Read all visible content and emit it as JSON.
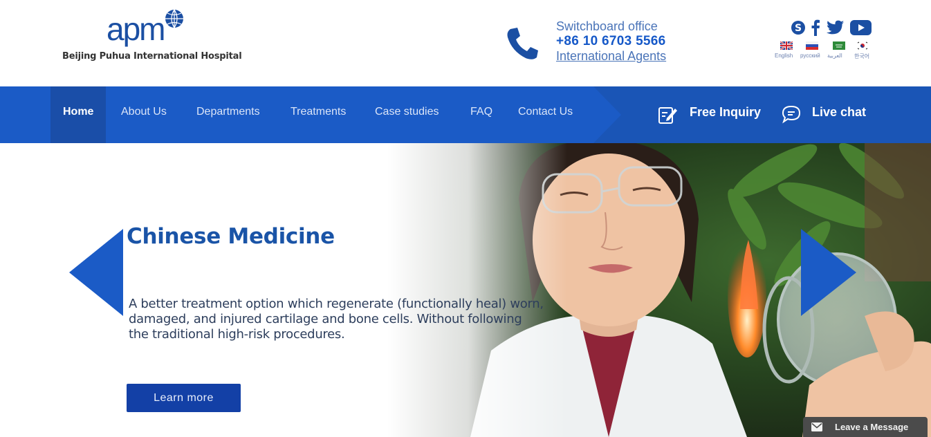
{
  "header": {
    "logo_text": "apm",
    "logo_subtitle": "Beijing Puhua International Hospital",
    "switchboard_title": "Switchboard office",
    "switchboard_phone": "+86 10 6703 5566",
    "agents_link": "International Agents",
    "social_icons": [
      "skype-icon",
      "facebook-icon",
      "twitter-icon",
      "youtube-icon"
    ],
    "languages": [
      {
        "label": "English",
        "flag": "uk-flag-icon"
      },
      {
        "label": "русский",
        "flag": "russia-flag-icon"
      },
      {
        "label": "العربية",
        "flag": "saudi-flag-icon"
      },
      {
        "label": "한국어",
        "flag": "korea-flag-icon"
      }
    ]
  },
  "nav": {
    "items": [
      "Home",
      "About Us",
      "Departments",
      "Treatments",
      "Case studies",
      "FAQ",
      "Contact Us"
    ],
    "active": "Home",
    "inquiry_label": "Free Inquiry",
    "chat_label": "Live chat"
  },
  "hero": {
    "title": "Chinese Medicine",
    "text": "A better treatment option which regenerate (functionally heal) worn, damaged, and injured cartilage and bone cells. Without following the traditional high-risk procedures.",
    "button_label": "Learn more"
  },
  "message_bar": {
    "label": "Leave a Message"
  },
  "colors": {
    "nav_blue": "#1b5bc6",
    "nav_dark": "#1a55b6",
    "title_blue": "#1a54a7",
    "button_blue": "#1340a6"
  }
}
